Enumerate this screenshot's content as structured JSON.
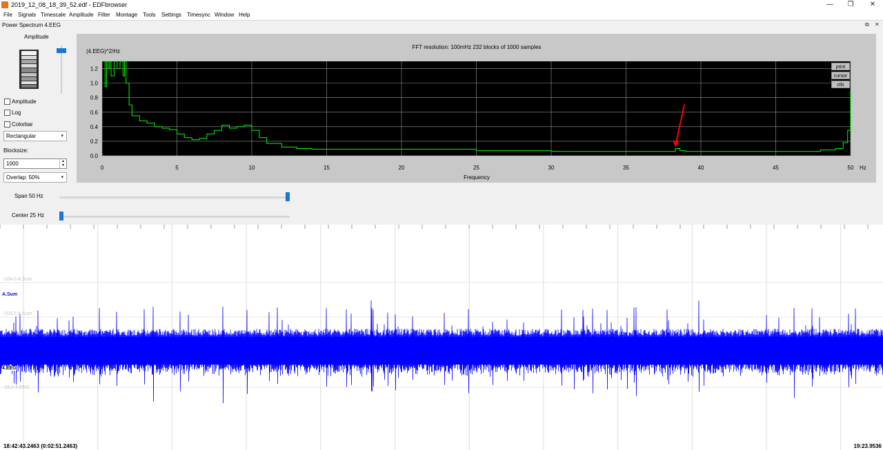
{
  "window": {
    "title": "2019_12_08_18_39_52.edf - EDFbrowser",
    "controls": {
      "minimize": "—",
      "maximize": "❐",
      "close": "✕"
    }
  },
  "menu": [
    "File",
    "Signals",
    "Timescale",
    "Amplitude",
    "Filter",
    "Montage",
    "Tools",
    "Settings",
    "Timesync",
    "Window",
    "Help"
  ],
  "subwindow": {
    "title": "Power Spectrum 4.EEG",
    "controls": {
      "restore": "⧉",
      "close": "✕"
    }
  },
  "left_panel": {
    "amplitude_label": "Amplitude",
    "checkboxes": {
      "amplitude": "Amplitude",
      "log": "Log",
      "colorbar": "Colorbar"
    },
    "window_type": "Rectangular",
    "blocksize_label": "Blocksize:",
    "blocksize_value": "1000",
    "overlap": "Overlap: 50%"
  },
  "plot_buttons": {
    "print": "print",
    "cursor": "cursor",
    "ctls": "ctls"
  },
  "sliders": {
    "span_label": "Span 50 Hz",
    "span_fraction": 1.0,
    "center_label": "Center 25 Hz",
    "center_fraction": 0.0
  },
  "colors": {
    "spectrum": "#00ff00",
    "signal": "#0000ff",
    "arrow": "#ff0000",
    "accent": "#1976d2"
  },
  "chart_data": {
    "type": "line",
    "title": "FFT resolution: 100mHz   232 blocks of 1000 samples",
    "ylabel": "(4.EEG)^2/Hz",
    "xlabel": "Frequency",
    "xunit": "Hz",
    "xlim": [
      0,
      50
    ],
    "ylim": [
      0,
      1.3
    ],
    "xticks": [
      "0",
      "5",
      "10",
      "15",
      "20",
      "25",
      "30",
      "35",
      "40",
      "45",
      "50"
    ],
    "yticks": [
      "0.0",
      "0.2",
      "0.4",
      "0.6",
      "0.8",
      "1.0",
      "1.2"
    ],
    "grid": true,
    "series": [
      {
        "x": [
          0.1,
          0.2,
          0.3,
          0.4,
          0.5,
          0.6,
          0.8,
          1.0,
          1.2,
          1.4,
          1.5,
          1.6,
          1.8,
          2.0,
          2.5,
          3.0,
          3.5,
          4.0,
          4.5,
          5.0,
          5.5,
          6.0,
          6.5,
          7.0,
          7.5,
          8.0,
          8.5,
          9.0,
          9.5,
          10.0,
          10.5,
          11.0,
          12.0,
          13.0,
          14.0,
          15.0,
          17.5,
          20.0,
          25.0,
          30.0,
          35.0,
          38.0,
          38.3,
          38.6,
          39.0,
          40.0,
          45.0,
          48.0,
          49.0,
          49.5,
          49.8,
          50.0
        ],
        "y": [
          1.3,
          0.95,
          1.3,
          1.2,
          1.3,
          1.1,
          1.3,
          1.2,
          1.3,
          1.1,
          1.3,
          1.0,
          0.7,
          0.55,
          0.48,
          0.45,
          0.4,
          0.38,
          0.36,
          0.3,
          0.25,
          0.22,
          0.24,
          0.3,
          0.35,
          0.42,
          0.38,
          0.4,
          0.42,
          0.35,
          0.25,
          0.17,
          0.12,
          0.1,
          0.09,
          0.09,
          0.09,
          0.09,
          0.07,
          0.06,
          0.06,
          0.06,
          0.1,
          0.07,
          0.06,
          0.06,
          0.06,
          0.08,
          0.1,
          0.18,
          0.35,
          0.9
        ]
      }
    ],
    "annotation": {
      "type": "arrow",
      "x": 38.3,
      "y": 0.1
    }
  },
  "signals": {
    "labels": [
      {
        "text": "-104.0 A.Sum"
      },
      {
        "text": "A.Sum"
      },
      {
        "text": "-203.2 A.Sum"
      },
      {
        "text": "4.EEG"
      },
      {
        "text": "-15.2 4.EEG"
      }
    ],
    "start_time": "18:42:43.2463 (0:02:51.2463)",
    "end_time": "19:23.9536"
  }
}
